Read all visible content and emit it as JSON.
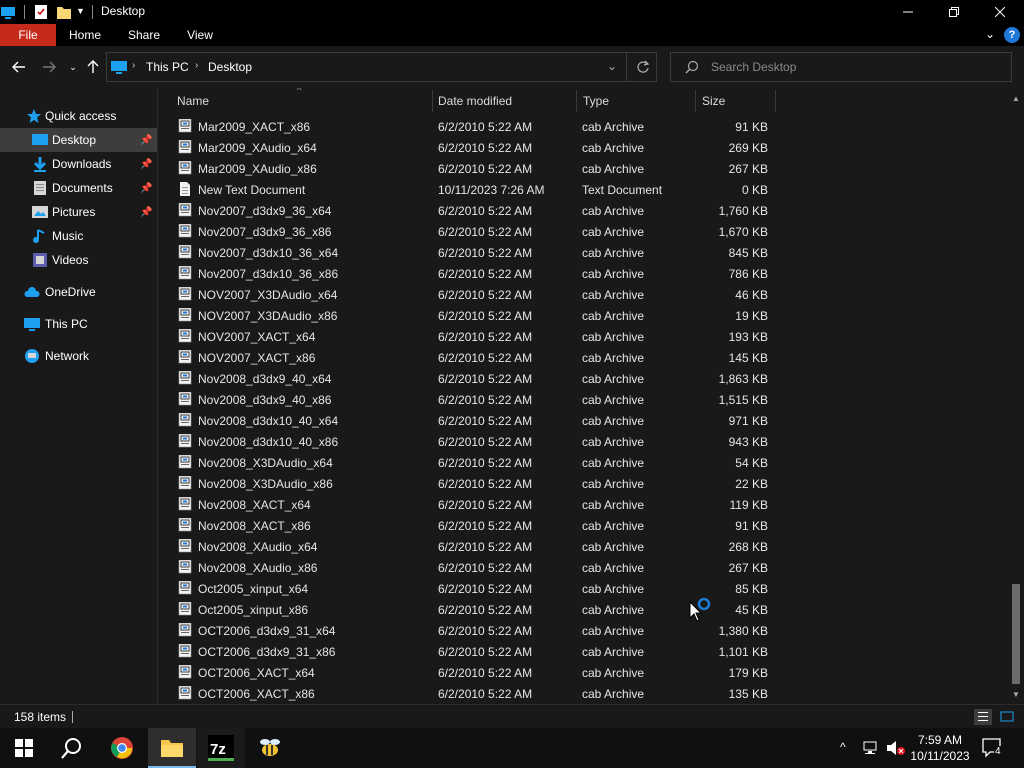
{
  "window": {
    "title": "Desktop"
  },
  "ribbon": {
    "tabs": [
      "File",
      "Home",
      "Share",
      "View"
    ]
  },
  "address": {
    "crumbs": [
      "This PC",
      "Desktop"
    ]
  },
  "search": {
    "placeholder": "Search Desktop"
  },
  "nav": {
    "items": [
      {
        "label": "Quick access",
        "icon": "star-icon"
      },
      {
        "label": "Desktop",
        "icon": "desktop-icon"
      },
      {
        "label": "Downloads",
        "icon": "download-icon"
      },
      {
        "label": "Documents",
        "icon": "documents-icon"
      },
      {
        "label": "Pictures",
        "icon": "pictures-icon"
      },
      {
        "label": "Music",
        "icon": "music-icon"
      },
      {
        "label": "Videos",
        "icon": "videos-icon"
      },
      {
        "label": "OneDrive",
        "icon": "cloud-icon"
      },
      {
        "label": "This PC",
        "icon": "computer-icon"
      },
      {
        "label": "Network",
        "icon": "network-icon"
      }
    ]
  },
  "columns": {
    "name": "Name",
    "date": "Date modified",
    "type": "Type",
    "size": "Size"
  },
  "files": [
    {
      "name": "Mar2009_XACT_x86",
      "date": "6/2/2010 5:22 AM",
      "type": "cab Archive",
      "size": "91 KB"
    },
    {
      "name": "Mar2009_XAudio_x64",
      "date": "6/2/2010 5:22 AM",
      "type": "cab Archive",
      "size": "269 KB"
    },
    {
      "name": "Mar2009_XAudio_x86",
      "date": "6/2/2010 5:22 AM",
      "type": "cab Archive",
      "size": "267 KB"
    },
    {
      "name": "New Text Document",
      "date": "10/11/2023 7:26 AM",
      "type": "Text Document",
      "size": "0 KB"
    },
    {
      "name": "Nov2007_d3dx9_36_x64",
      "date": "6/2/2010 5:22 AM",
      "type": "cab Archive",
      "size": "1,760 KB"
    },
    {
      "name": "Nov2007_d3dx9_36_x86",
      "date": "6/2/2010 5:22 AM",
      "type": "cab Archive",
      "size": "1,670 KB"
    },
    {
      "name": "Nov2007_d3dx10_36_x64",
      "date": "6/2/2010 5:22 AM",
      "type": "cab Archive",
      "size": "845 KB"
    },
    {
      "name": "Nov2007_d3dx10_36_x86",
      "date": "6/2/2010 5:22 AM",
      "type": "cab Archive",
      "size": "786 KB"
    },
    {
      "name": "NOV2007_X3DAudio_x64",
      "date": "6/2/2010 5:22 AM",
      "type": "cab Archive",
      "size": "46 KB"
    },
    {
      "name": "NOV2007_X3DAudio_x86",
      "date": "6/2/2010 5:22 AM",
      "type": "cab Archive",
      "size": "19 KB"
    },
    {
      "name": "NOV2007_XACT_x64",
      "date": "6/2/2010 5:22 AM",
      "type": "cab Archive",
      "size": "193 KB"
    },
    {
      "name": "NOV2007_XACT_x86",
      "date": "6/2/2010 5:22 AM",
      "type": "cab Archive",
      "size": "145 KB"
    },
    {
      "name": "Nov2008_d3dx9_40_x64",
      "date": "6/2/2010 5:22 AM",
      "type": "cab Archive",
      "size": "1,863 KB"
    },
    {
      "name": "Nov2008_d3dx9_40_x86",
      "date": "6/2/2010 5:22 AM",
      "type": "cab Archive",
      "size": "1,515 KB"
    },
    {
      "name": "Nov2008_d3dx10_40_x64",
      "date": "6/2/2010 5:22 AM",
      "type": "cab Archive",
      "size": "971 KB"
    },
    {
      "name": "Nov2008_d3dx10_40_x86",
      "date": "6/2/2010 5:22 AM",
      "type": "cab Archive",
      "size": "943 KB"
    },
    {
      "name": "Nov2008_X3DAudio_x64",
      "date": "6/2/2010 5:22 AM",
      "type": "cab Archive",
      "size": "54 KB"
    },
    {
      "name": "Nov2008_X3DAudio_x86",
      "date": "6/2/2010 5:22 AM",
      "type": "cab Archive",
      "size": "22 KB"
    },
    {
      "name": "Nov2008_XACT_x64",
      "date": "6/2/2010 5:22 AM",
      "type": "cab Archive",
      "size": "119 KB"
    },
    {
      "name": "Nov2008_XACT_x86",
      "date": "6/2/2010 5:22 AM",
      "type": "cab Archive",
      "size": "91 KB"
    },
    {
      "name": "Nov2008_XAudio_x64",
      "date": "6/2/2010 5:22 AM",
      "type": "cab Archive",
      "size": "268 KB"
    },
    {
      "name": "Nov2008_XAudio_x86",
      "date": "6/2/2010 5:22 AM",
      "type": "cab Archive",
      "size": "267 KB"
    },
    {
      "name": "Oct2005_xinput_x64",
      "date": "6/2/2010 5:22 AM",
      "type": "cab Archive",
      "size": "85 KB"
    },
    {
      "name": "Oct2005_xinput_x86",
      "date": "6/2/2010 5:22 AM",
      "type": "cab Archive",
      "size": "45 KB"
    },
    {
      "name": "OCT2006_d3dx9_31_x64",
      "date": "6/2/2010 5:22 AM",
      "type": "cab Archive",
      "size": "1,380 KB"
    },
    {
      "name": "OCT2006_d3dx9_31_x86",
      "date": "6/2/2010 5:22 AM",
      "type": "cab Archive",
      "size": "1,101 KB"
    },
    {
      "name": "OCT2006_XACT_x64",
      "date": "6/2/2010 5:22 AM",
      "type": "cab Archive",
      "size": "179 KB"
    },
    {
      "name": "OCT2006_XACT_x86",
      "date": "6/2/2010 5:22 AM",
      "type": "cab Archive",
      "size": "135 KB"
    }
  ],
  "status": {
    "count": "158 items"
  },
  "taskbar": {
    "apps": [
      "start-icon",
      "search-icon",
      "chrome-icon",
      "file-explorer-icon",
      "7zip-icon",
      "bee-app-icon"
    ],
    "time": "7:59 AM",
    "date": "10/11/2023",
    "notifications": "4"
  },
  "colors": {
    "accent": "#c42b1c",
    "selection": "#3d3d3d",
    "taskbar_indicator": "#76b9ed"
  }
}
